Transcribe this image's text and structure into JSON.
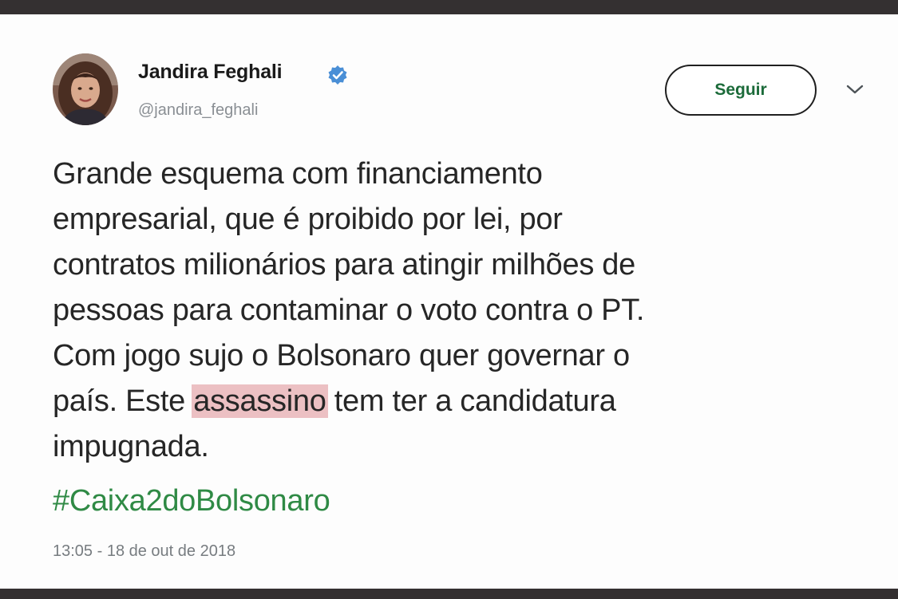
{
  "tweet": {
    "author": {
      "name": "Jandira Feghali",
      "handle": "@jandira_feghali",
      "verified": true,
      "avatar": "profile-photo"
    },
    "follow_button_label": "Seguir",
    "menu_icon": "chevron-down-icon",
    "text_lines": [
      "Grande esquema com financiamento",
      "empresarial, que é proibido por lei, por",
      "contratos milionários para atingir milhões de",
      "pessoas para contaminar o voto contra o PT.",
      "Com jogo sujo o Bolsonaro quer governar o"
    ],
    "line6": {
      "before": "país. Este ",
      "highlighted": "assassino",
      "after": " tem ter a candidatura"
    },
    "line7": "impugnada.",
    "hashtag": "#Caixa2doBolsonaro",
    "timestamp": "13:05 - 18 de out de 2018"
  },
  "colors": {
    "frame": "#343031",
    "card_background": "#fdfdfd",
    "verified_badge": "#4a8fd6",
    "follow_text": "#1c6b3a",
    "hashtag": "#2f8a45",
    "highlight": "#ecc0c3",
    "secondary_text": "#8a8f94"
  }
}
